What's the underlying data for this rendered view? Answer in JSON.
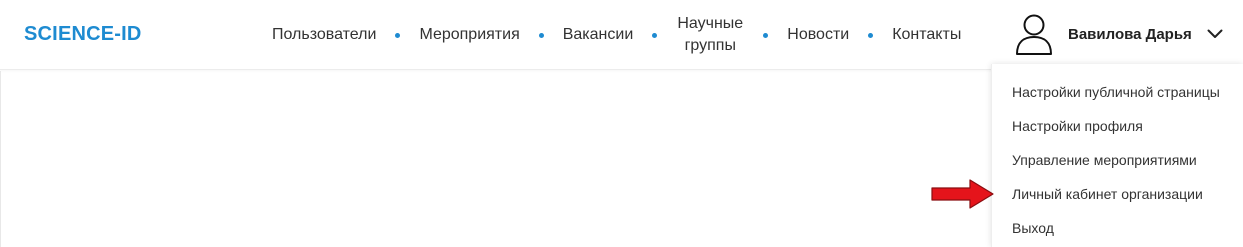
{
  "brand": {
    "logo_text": "SCIENCE-ID",
    "accent_color": "#1e8bd1"
  },
  "nav": {
    "items": [
      {
        "label": "Пользователи"
      },
      {
        "label": "Мероприятия"
      },
      {
        "label": "Вакансии"
      },
      {
        "label": "Научные группы"
      },
      {
        "label": "Новости"
      },
      {
        "label": "Контакты"
      }
    ]
  },
  "user": {
    "name": "Вавилова Дарья",
    "avatar_icon": "user-outline-icon",
    "menu_toggle_icon": "chevron-down-icon"
  },
  "user_menu": {
    "items": [
      {
        "label": "Настройки публичной страницы"
      },
      {
        "label": "Настройки профиля"
      },
      {
        "label": "Управление мероприятиями"
      },
      {
        "label": "Личный кабинет организации",
        "highlighted": true
      },
      {
        "label": "Выход"
      }
    ]
  },
  "annotation": {
    "icon": "red-arrow-right-icon",
    "color": "#e5141b"
  }
}
